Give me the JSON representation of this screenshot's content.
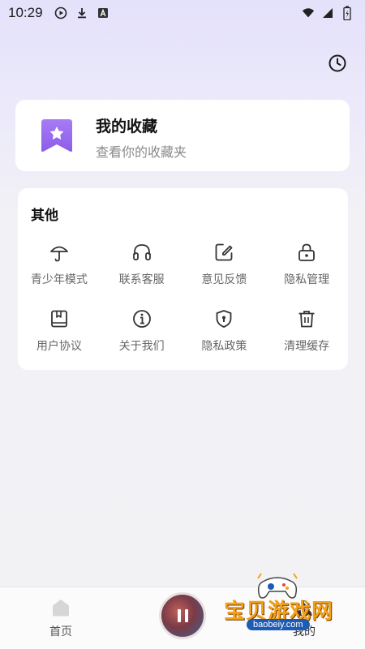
{
  "status_bar": {
    "time": "10:29",
    "icons_left": [
      "play-circle-icon",
      "download-icon",
      "a-badge-icon"
    ],
    "icons_right": [
      "wifi-icon",
      "signal-icon",
      "battery-icon"
    ]
  },
  "favorites": {
    "title": "我的收藏",
    "subtitle": "查看你的收藏夹",
    "icon": "bookmark-star-icon",
    "accent": "#9a6df0"
  },
  "other": {
    "title": "其他",
    "items": [
      {
        "label": "青少年模式",
        "icon": "umbrella-icon"
      },
      {
        "label": "联系客服",
        "icon": "headphones-icon"
      },
      {
        "label": "意见反馈",
        "icon": "edit-square-icon"
      },
      {
        "label": "隐私管理",
        "icon": "lock-icon"
      },
      {
        "label": "用户协议",
        "icon": "book-icon"
      },
      {
        "label": "关于我们",
        "icon": "info-icon"
      },
      {
        "label": "隐私政策",
        "icon": "shield-icon"
      },
      {
        "label": "清理缓存",
        "icon": "trash-icon"
      }
    ]
  },
  "bottom_nav": {
    "home_label": "首页",
    "mine_label": "我的"
  },
  "watermark": {
    "text": "宝贝游戏网",
    "url": "baobeiy.com"
  }
}
